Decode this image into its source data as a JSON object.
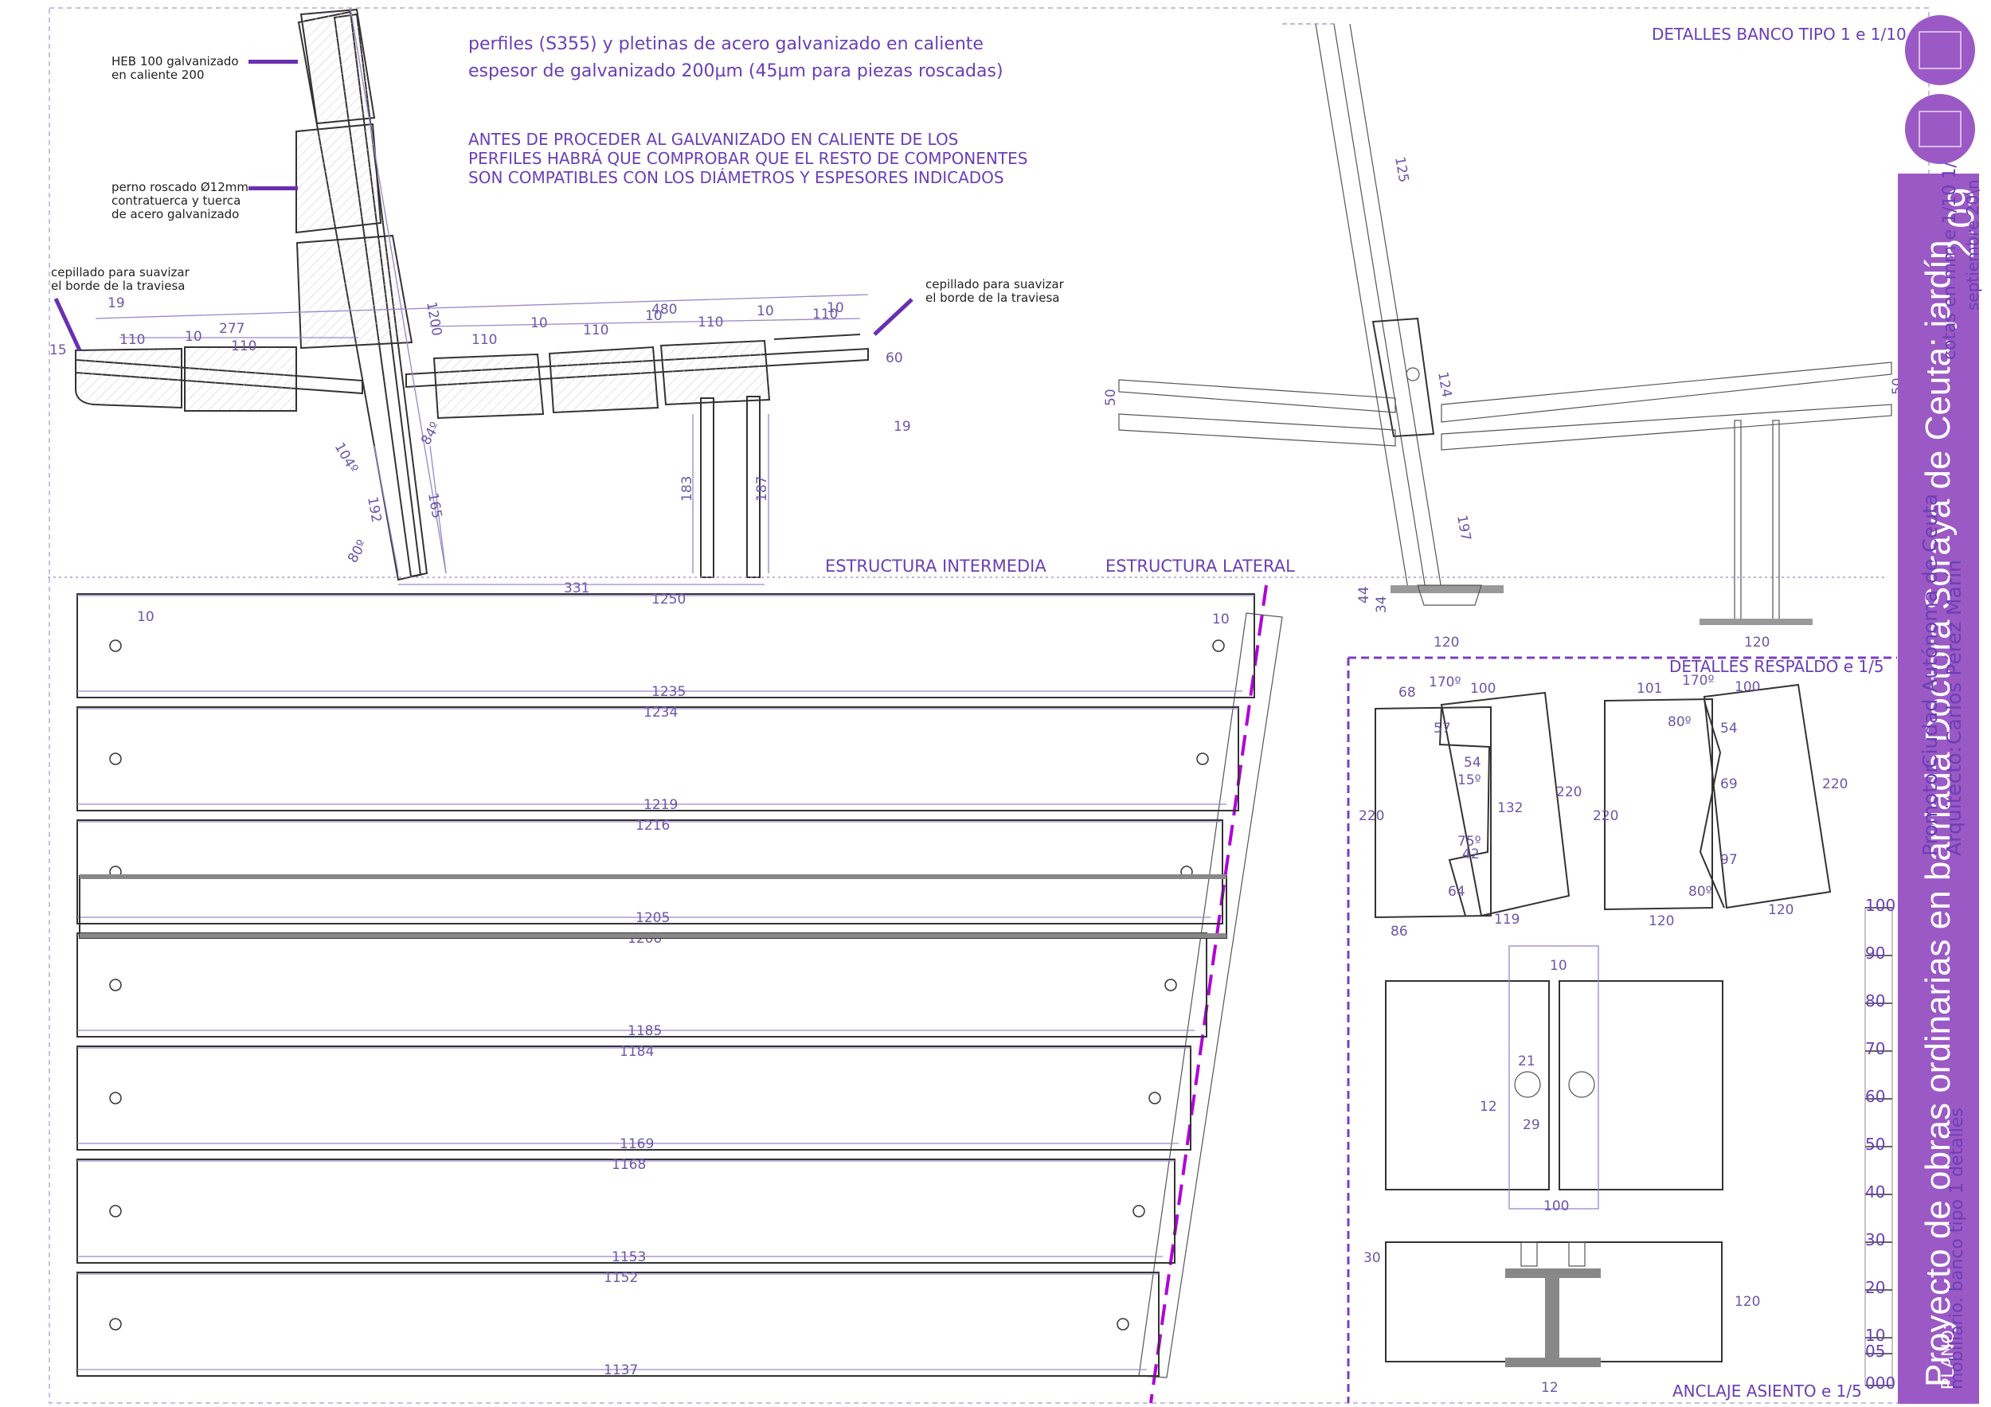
{
  "sheet": {
    "accent": "#9b59c5",
    "title": "Proyecto de obras ordinarias en barriada Doctora Soraya de Ceuta: jardín",
    "plan_number": "2.09",
    "units_scale": "cotas en mm  e 1/10  1/5",
    "date": "septiembre 20\\n",
    "promotor_label": "Promotor:",
    "promotor": "Ciudad Autónoma de Ceuta",
    "arquitecto_label": "Arquitecto:",
    "arquitecto": "Carlos Pérez Marín",
    "plano_label": "PLANO:",
    "plano": "mobiliario. banco tipo 1 detalles"
  },
  "headers": {
    "detalles_banco": "DETALLES BANCO TIPO 1  e 1/10",
    "estructura_intermedia": "ESTRUCTURA INTERMEDIA",
    "estructura_lateral": "ESTRUCTURA LATERAL",
    "detalles_respaldo": "DETALLES RESPALDO  e 1/5",
    "anclaje_asiento": "ANCLAJE ASIENTO  e 1/5"
  },
  "notes": {
    "line1": "perfiles (S355) y pletinas de acero galvanizado en caliente",
    "line2": "espesor de galvanizado 200µm (45µm para piezas roscadas)",
    "warn1": "ANTES DE PROCEDER AL GALVANIZADO EN CALIENTE DE LOS",
    "warn2": "PERFILES HABRÁ QUE COMPROBAR QUE EL RESTO DE COMPONENTES",
    "warn3": "SON COMPATIBLES CON LOS DIÁMETROS Y ESPESORES INDICADOS",
    "heb1": "HEB 100 galvanizado",
    "heb2": "en caliente 200",
    "perno1": "perno roscado Ø12mm",
    "perno2": "contratuerca y tuerca",
    "perno3": "de acero galvanizado",
    "cep1": "cepillado para suavizar",
    "cep2": "el borde de la traviesa"
  },
  "dims_section": [
    "19",
    "277",
    "110",
    "10",
    "110",
    "15",
    "10",
    "110",
    "10",
    "110",
    "10",
    "110",
    "10",
    "110",
    "480",
    "60",
    "19",
    "1200",
    "104º",
    "84º",
    "80º",
    "192",
    "165",
    "183",
    "187",
    "331"
  ],
  "dims_lateral": [
    "125",
    "124",
    "50",
    "50",
    "197",
    "44",
    "34",
    "120",
    "120"
  ],
  "plank_dims": [
    {
      "top": "1250",
      "bottom": "1235"
    },
    {
      "top": "1234",
      "bottom": "1219"
    },
    {
      "top": "1216",
      "bottom": "1205"
    },
    {
      "top": "1200",
      "bottom": "1185"
    },
    {
      "top": "1184",
      "bottom": "1169"
    },
    {
      "top": "1168",
      "bottom": "1153"
    },
    {
      "top": "1152",
      "bottom": "1137"
    }
  ],
  "plank_small": [
    "10",
    "10"
  ],
  "respaldo_left": [
    "68",
    "170º",
    "100",
    "57",
    "54",
    "15º",
    "132",
    "220",
    "220",
    "75º",
    "42",
    "64",
    "86",
    "119"
  ],
  "respaldo_right": [
    "101",
    "170º",
    "100",
    "80º",
    "54",
    "69",
    "220",
    "220",
    "97",
    "80º",
    "120",
    "120"
  ],
  "anclaje": [
    "10",
    "21",
    "12",
    "29",
    "100",
    "30",
    "120",
    "12"
  ],
  "scale_bar": [
    "100",
    "90",
    "80",
    "70",
    "60",
    "50",
    "40",
    "30",
    "20",
    "10",
    "05",
    "000"
  ]
}
